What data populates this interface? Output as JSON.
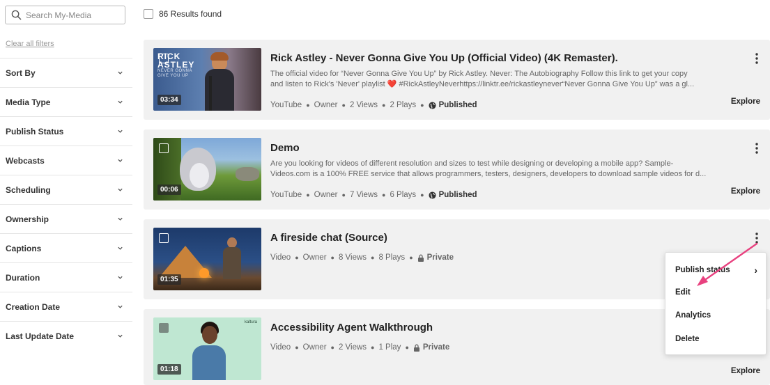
{
  "sidebar": {
    "search_placeholder": "Search My-Media",
    "clear_filters": "Clear all filters",
    "filters": [
      {
        "label": "Sort By"
      },
      {
        "label": "Media Type"
      },
      {
        "label": "Publish Status"
      },
      {
        "label": "Webcasts"
      },
      {
        "label": "Scheduling"
      },
      {
        "label": "Ownership"
      },
      {
        "label": "Captions"
      },
      {
        "label": "Duration"
      },
      {
        "label": "Creation Date"
      },
      {
        "label": "Last Update Date"
      }
    ]
  },
  "results": {
    "count_label": "86 Results found"
  },
  "cards": [
    {
      "title": "Rick Astley - Never Gonna Give You Up (Official Video) (4K Remaster).",
      "thumb_text": "RICK ASTLEY",
      "thumb_sub": "NEVER GONNA GIVE YOU UP",
      "duration": "03:34",
      "desc_line1": "The official video for “Never Gonna Give You Up” by Rick Astley. Never: The Autobiography Follow this link to get your copy",
      "desc_line2": "and listen to Rick's 'Never' playlist ❤️ #RickAstleyNeverhttps://linktr.ee/rickastleynever“Never Gonna Give You Up” was a gl...",
      "meta": [
        "YouTube",
        "Owner",
        "2 Views",
        "2 Plays"
      ],
      "status": "Published",
      "explore": "Explore"
    },
    {
      "title": "Demo",
      "duration": "00:06",
      "desc_line1": "Are you looking for videos of different resolution and sizes to test while designing or developing a mobile app? Sample-",
      "desc_line2": "Videos.com is a 100% FREE service that allows programmers, testers, designers, developers to download sample videos for d...",
      "meta": [
        "YouTube",
        "Owner",
        "7 Views",
        "6 Plays"
      ],
      "status": "Published",
      "explore": "Explore"
    },
    {
      "title": "A fireside chat (Source)",
      "duration": "01:35",
      "meta": [
        "Video",
        "Owner",
        "8 Views",
        "8 Plays"
      ],
      "status": "Private"
    },
    {
      "title": "Accessibility Agent Walkthrough",
      "thumb_brand": "kaltura",
      "duration": "01:18",
      "meta": [
        "Video",
        "Owner",
        "2 Views",
        "1 Play"
      ],
      "status": "Private",
      "explore": "Explore"
    }
  ],
  "menu": {
    "items": [
      {
        "label": "Publish status",
        "submenu_glyph": "›"
      },
      {
        "label": "Edit"
      },
      {
        "label": "Analytics"
      },
      {
        "label": "Delete"
      }
    ]
  },
  "colors": {
    "accent_arrow": "#e8417f",
    "card_bg": "#f1f1f1"
  }
}
